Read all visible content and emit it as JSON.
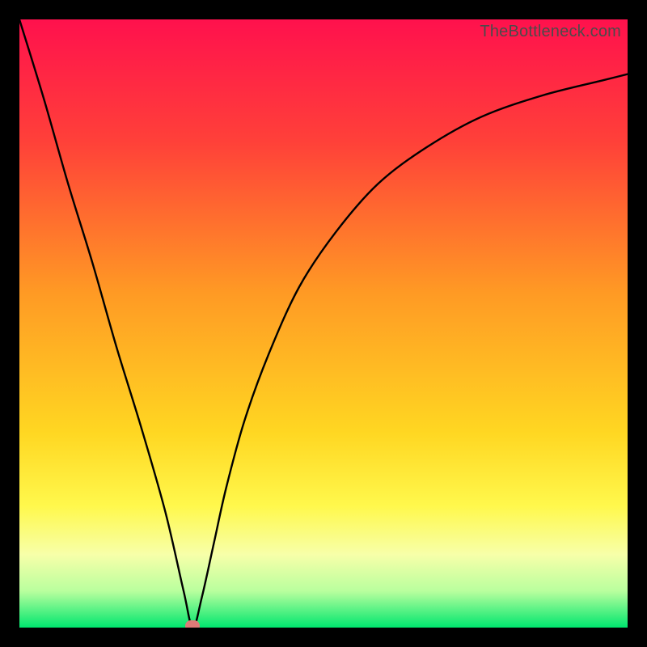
{
  "watermark": "TheBottleneck.com",
  "chart_data": {
    "type": "line",
    "title": "",
    "xlabel": "",
    "ylabel": "",
    "xlim": [
      0,
      100
    ],
    "ylim": [
      0,
      100
    ],
    "grid": false,
    "legend": false,
    "background_gradient": {
      "type": "vertical",
      "stops": [
        {
          "pos": 0.0,
          "color": "#ff114d"
        },
        {
          "pos": 0.2,
          "color": "#ff4039"
        },
        {
          "pos": 0.45,
          "color": "#ff9a24"
        },
        {
          "pos": 0.68,
          "color": "#ffd722"
        },
        {
          "pos": 0.8,
          "color": "#fff84c"
        },
        {
          "pos": 0.88,
          "color": "#f7ffa9"
        },
        {
          "pos": 0.94,
          "color": "#b9ff9e"
        },
        {
          "pos": 1.0,
          "color": "#00e66e"
        }
      ]
    },
    "series": [
      {
        "name": "bottleneck-curve",
        "color": "#000000",
        "x": [
          0,
          4,
          8,
          12,
          16,
          20,
          24,
          27,
          28.5,
          30,
          32,
          34,
          37,
          41,
          46,
          52,
          59,
          67,
          76,
          86,
          96,
          100
        ],
        "y": [
          100,
          87,
          73,
          60,
          46,
          33,
          19,
          6,
          0,
          5,
          14,
          23,
          34,
          45,
          56,
          65,
          73,
          79,
          84,
          87.5,
          90,
          91
        ]
      }
    ],
    "marker": {
      "x": 28.5,
      "y": 0,
      "color": "#df7b78",
      "shape": "pill"
    }
  }
}
